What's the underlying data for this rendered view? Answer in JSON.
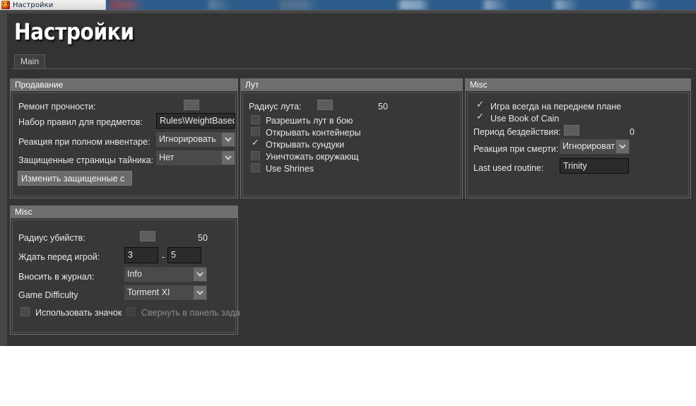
{
  "taskbar": {
    "window_button_label": "Настройки",
    "window_button_icon": "app-icon"
  },
  "window": {
    "title": "Настройки",
    "tabs": [
      {
        "label": "Main",
        "active": true
      }
    ]
  },
  "panels": {
    "selling": {
      "title": "Продавание",
      "fields": {
        "repair_durability_label": "Ремонт прочности:",
        "item_ruleset_label": "Набор правил для предметов:",
        "item_ruleset_value": "Rules\\WeightBased",
        "full_inventory_label": "Реакция при полном инвентаре:",
        "full_inventory_value": "Игнорировать",
        "protected_stash_label": "Защищенные страницы тайника:",
        "protected_stash_value": "Нет",
        "edit_protected_button": "Изменить защищенные с"
      }
    },
    "loot": {
      "title": "Лут",
      "fields": {
        "loot_radius_label": "Радиус лута:",
        "loot_radius_value": "50"
      },
      "checkboxes": [
        {
          "label": "Разрешить лут в бою",
          "checked": false
        },
        {
          "label": "Открывать контейнеры",
          "checked": false
        },
        {
          "label": "Открывать сундуки",
          "checked": true
        },
        {
          "label": "Уничтожать окружающ",
          "checked": false
        },
        {
          "label": "Use Shrines",
          "checked": false
        }
      ]
    },
    "misc_right": {
      "title": "Misc",
      "checkboxes": [
        {
          "label": "Игра всегда на переднем плане",
          "checked": true
        },
        {
          "label": "Use Book of Cain",
          "checked": true
        }
      ],
      "fields": {
        "idle_period_label": "Период бездействия:",
        "idle_period_value": "0",
        "death_reaction_label": "Реакция при смерти:",
        "death_reaction_value": "Игнорировать",
        "last_routine_label": "Last used routine:",
        "last_routine_value": "Trinity"
      }
    },
    "misc_bottom": {
      "title": "Misc",
      "fields": {
        "kill_radius_label": "Радиус убийств:",
        "kill_radius_value": "50",
        "wait_before_game_label": "Ждать перед игрой:",
        "wait_min": "3",
        "wait_separator": "-",
        "wait_max": "5",
        "log_level_label": "Вносить в журнал:",
        "log_level_value": "Info",
        "game_difficulty_label": "Game Difficulty",
        "game_difficulty_value": "Torment XI"
      },
      "checkboxes": [
        {
          "label": "Использовать значок",
          "checked": false,
          "disabled": false
        },
        {
          "label": "Свернуть в панель зада",
          "checked": false,
          "disabled": true
        }
      ]
    }
  },
  "colors": {
    "window_bg": "#333333",
    "panel_bg": "#383838",
    "panel_border": "#6e6e6e",
    "header_bg": "#6e6e6e",
    "text": "#e8e8e8",
    "text_dim": "#8b8b8b",
    "input_bg": "#2b2b2b",
    "combo_bg": "#4a4a4a"
  }
}
